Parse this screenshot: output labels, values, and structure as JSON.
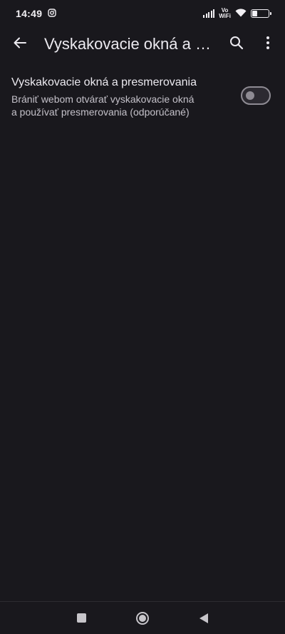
{
  "status_bar": {
    "time": "14:49",
    "notification_icon": "instagram-icon",
    "vowifi_top": "Vo",
    "vowifi_bottom": "WiFi",
    "battery_level": "29"
  },
  "app_bar": {
    "title": "Vyskakovacie okná a pr...",
    "back_icon": "arrow-back-icon",
    "search_icon": "search-icon",
    "more_icon": "more-vert-icon"
  },
  "setting": {
    "title": "Vyskakovacie okná a presmerovania",
    "description_line1": "Brániť webom otvárať vyskakovacie okná",
    "description_line2": "a používať presmerovania (odporúčané)",
    "toggle_on": false
  },
  "nav_bar": {
    "recents_icon": "square-icon",
    "home_icon": "circle-icon",
    "back_icon": "triangle-back-icon"
  },
  "colors": {
    "background": "#19181d",
    "text_primary": "#eceaf0",
    "text_secondary": "#c4c1c9",
    "toggle_outline": "#8e8b93"
  }
}
